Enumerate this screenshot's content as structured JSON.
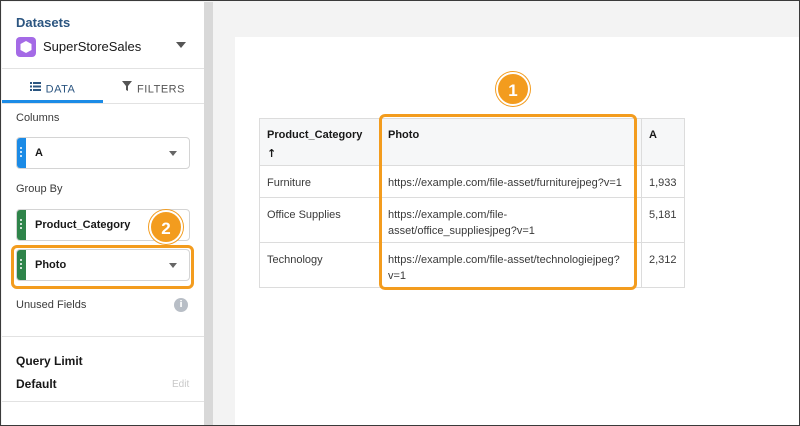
{
  "sidebar": {
    "title": "Datasets",
    "dataset_name": "SuperStoreSales",
    "tabs": [
      {
        "label": "DATA",
        "icon": "list-icon"
      },
      {
        "label": "FILTERS",
        "icon": "filter-icon"
      }
    ],
    "columns_label": "Columns",
    "columns_field": "A",
    "group_by_label": "Group By",
    "group_by_fields": [
      "Product_Category",
      "Photo"
    ],
    "unused_fields_label": "Unused Fields",
    "query_limit_label": "Query Limit",
    "query_limit_value": "Default",
    "edit_label": "Edit"
  },
  "table": {
    "headers": [
      "Product_Category",
      "Photo",
      "A"
    ],
    "sort_indicator": "↑",
    "rows": [
      [
        "Furniture",
        "https://example.com/file-asset/furniturejpeg?v=1",
        "1,933"
      ],
      [
        "Office Supplies",
        "https://example.com/file-asset/office_suppliesjpeg?v=1",
        "5,181"
      ],
      [
        "Technology",
        "https://example.com/file-asset/technologiejpeg?v=1",
        "2,312"
      ]
    ]
  },
  "callouts": [
    "1",
    "2"
  ],
  "colors": {
    "accent_orange": "#f39c1e",
    "tab_blue": "#1b8be6",
    "measure_blue": "#1b8be6",
    "dimension_green": "#2e844a",
    "dataset_purple": "#a46ae6"
  }
}
